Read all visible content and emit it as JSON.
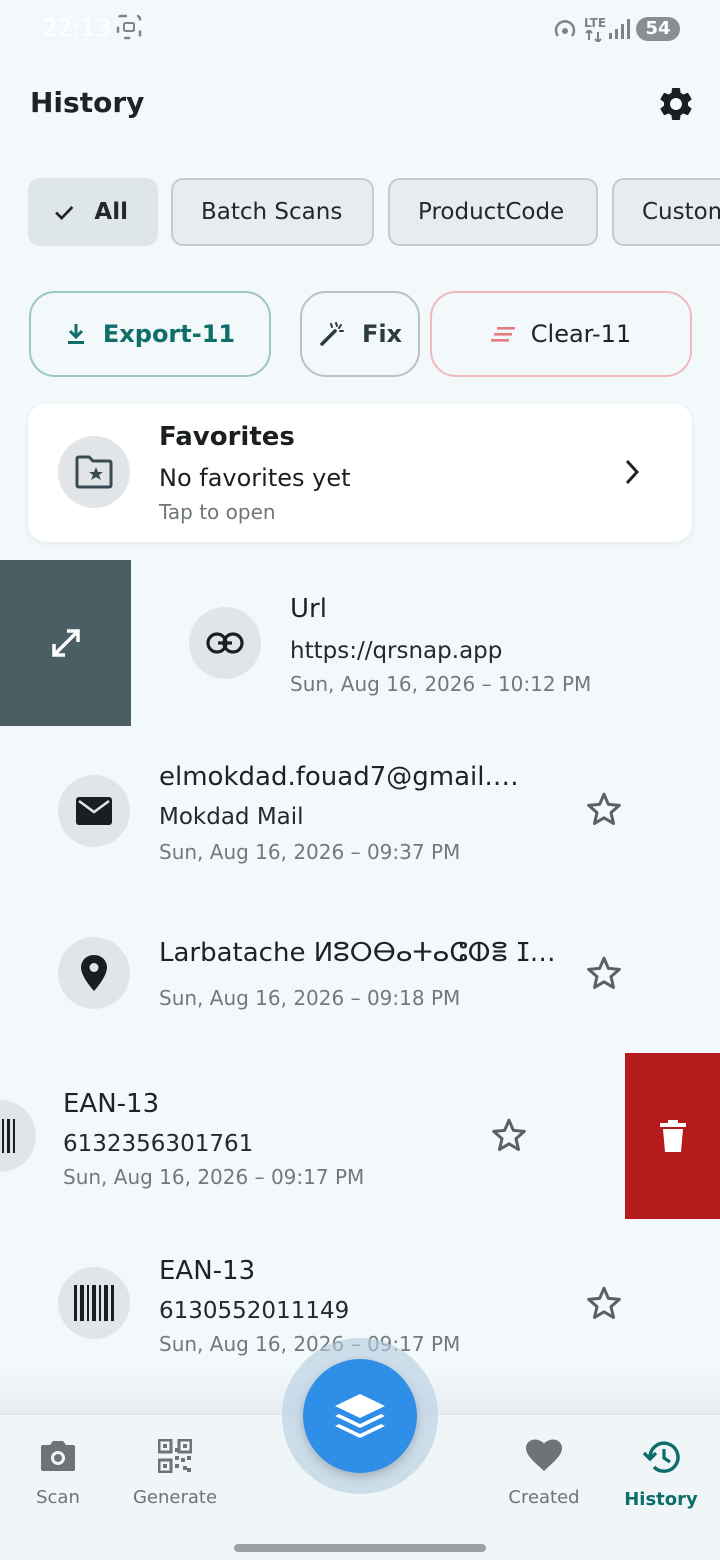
{
  "status_bar": {
    "time": "22:13",
    "network": "LTE",
    "battery": "54"
  },
  "header": {
    "title": "History"
  },
  "filters": [
    {
      "label": "All",
      "selected": true
    },
    {
      "label": "Batch Scans",
      "selected": false
    },
    {
      "label": "ProductCode",
      "selected": false
    },
    {
      "label": "Custom",
      "selected": false
    }
  ],
  "actions": {
    "export_label": "Export-11",
    "fix_label": "Fix",
    "clear_label": "Clear-11"
  },
  "favorites": {
    "title": "Favorites",
    "subtitle": "No favorites yet",
    "hint": "Tap to open"
  },
  "items": [
    {
      "title": "Url",
      "value": "https://qrsnap.app",
      "date": "Sun, Aug 16, 2026 – 10:12 PM",
      "icon": "link-icon"
    },
    {
      "title": "elmokdad.fouad7@gmail.…",
      "value": "Mokdad Mail",
      "date": "Sun, Aug 16, 2026 – 09:37 PM",
      "icon": "mail-icon"
    },
    {
      "title": "Larbatache ⵍⵓⵔⴱⴰⵜⴰⵛⵀⴻ ⵊ…",
      "value": "",
      "date": "Sun, Aug 16, 2026 – 09:18 PM",
      "icon": "location-pin-icon"
    },
    {
      "title": "EAN-13",
      "value": "6132356301761",
      "date": "Sun, Aug 16, 2026 – 09:17 PM",
      "icon": "barcode-icon"
    },
    {
      "title": "EAN-13",
      "value": "6130552011149",
      "date": "Sun, Aug 16, 2026 – 09:17 PM",
      "icon": "barcode-icon"
    }
  ],
  "bottom_nav": [
    {
      "label": "Scan",
      "icon": "camera-icon",
      "active": false
    },
    {
      "label": "Generate",
      "icon": "qr-code-icon",
      "active": false
    },
    {
      "label": "Created",
      "icon": "heart-icon",
      "active": false
    },
    {
      "label": "History",
      "icon": "history-icon",
      "active": true
    }
  ],
  "colors": {
    "accent": "#0d6d6a",
    "fab": "#2f8ee8",
    "delete": "#b51b1c",
    "swipe_action": "#4a5e63"
  }
}
